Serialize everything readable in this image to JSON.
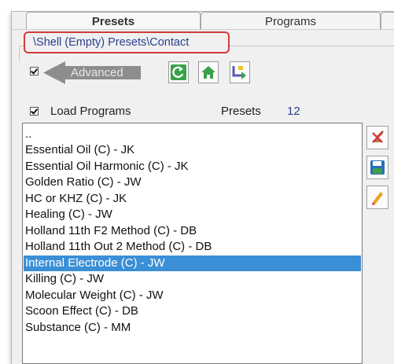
{
  "tabs": [
    {
      "label": "Presets"
    },
    {
      "label": "Programs"
    }
  ],
  "path": "\\Shell (Empty) Presets\\Contact",
  "advanced": {
    "label": "Advanced",
    "checked": true
  },
  "load_programs": {
    "label": "Load Programs",
    "checked": true
  },
  "presets": {
    "label": "Presets",
    "count": "12"
  },
  "list": {
    "items": [
      "..",
      "Essential Oil (C) - JK",
      "Essential Oil Harmonic (C) - JK",
      "Golden Ratio (C) - JW",
      "HC or KHZ (C) - JK",
      "Healing (C) - JW",
      "Holland 11th F2 Method (C) - DB",
      "Holland 11th Out 2 Method (C) - DB",
      "Internal Electrode (C) - JW",
      "Killing (C) - JW",
      "Molecular Weight (C) - JW",
      "Scoon Effect (C) - DB",
      "Substance (C) - MM"
    ],
    "selected_index": 8
  },
  "colors": {
    "selection": "#3b8fd6",
    "path_border": "#d63a3a",
    "accent_green": "#3aa14a"
  },
  "icons": {
    "toolbar": [
      "refresh-icon",
      "home-icon",
      "up-folder-icon"
    ],
    "side": [
      "clear-icon",
      "save-icon",
      "edit-icon"
    ]
  }
}
